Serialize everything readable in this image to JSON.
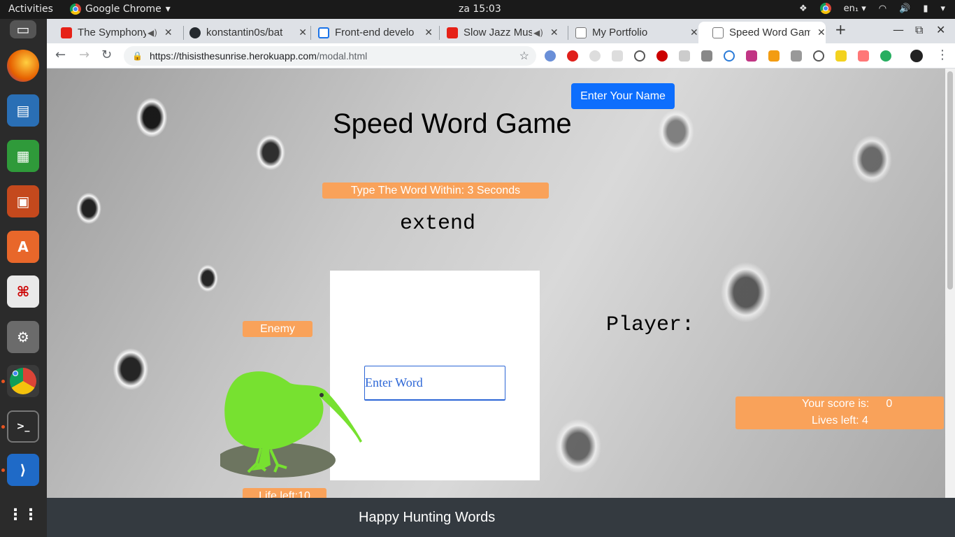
{
  "topbar": {
    "activities": "Activities",
    "app_name": "Google Chrome",
    "clock": "za 15:03",
    "keyboard": "en₁"
  },
  "tabs": [
    {
      "title": "The Symphony",
      "favicon": "youtube-icon",
      "audio": true
    },
    {
      "title": "konstantin0s/bat",
      "favicon": "github-icon",
      "audio": false
    },
    {
      "title": "Front-end develo",
      "favicon": "page-icon",
      "audio": false
    },
    {
      "title": "Slow Jazz Mus",
      "favicon": "youtube-icon",
      "audio": true
    },
    {
      "title": "My Portfolio",
      "favicon": "page-icon",
      "audio": false
    },
    {
      "title": "Speed Word Gam",
      "favicon": "page-icon",
      "audio": false,
      "active": true
    }
  ],
  "omnibox": {
    "host": "https://thisisthesunrise.herokuapp.com",
    "path": "/modal.html"
  },
  "page": {
    "name_button": "Enter Your Name",
    "title": "Speed Word Game",
    "timer_text": "Type The Word Within: 3 Seconds",
    "current_word": "extend",
    "input_placeholder": "Enter Word",
    "enemy_label": "Enemy",
    "enemy_life": "Life left:10",
    "player_label": "Player:",
    "score_label": "Your score is:",
    "score_value": "0",
    "lives_text": "Lives left: 4",
    "footer": "Happy Hunting Words"
  },
  "colors": {
    "accent_orange": "#f9a25a",
    "button_blue": "#0d6efd",
    "kiwi_green": "#77e130",
    "footer_bg": "#343a40"
  }
}
